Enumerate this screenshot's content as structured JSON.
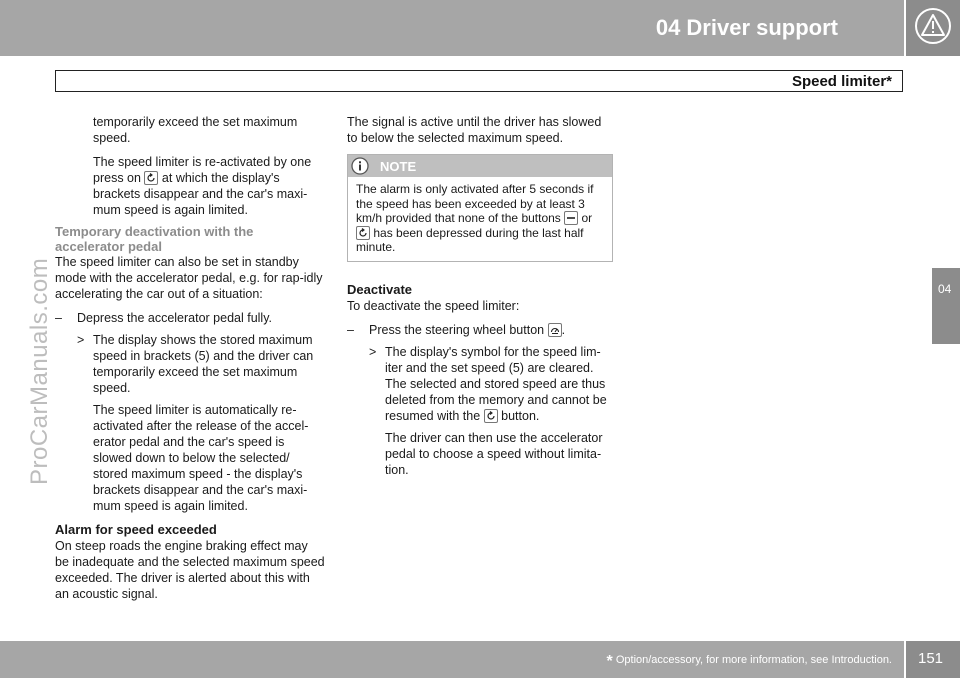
{
  "header": {
    "chapter_title": "04  Driver support",
    "section_title": "Speed limiter*",
    "icon": "warning-triangle-icon"
  },
  "side_tab": {
    "label": "04"
  },
  "watermark": "ProCarManuals.com",
  "footer": {
    "asterisk": "*",
    "note": "Option/accessory, for more information, see Introduction.",
    "page_number": "151"
  },
  "col1": {
    "p1": "temporarily exceed the set maximum speed.",
    "p2_a": "The speed limiter is re-activated by one press on",
    "p2_b": "at which the display's brackets disappear and the car's maxi-mum speed is again limited.",
    "heading_temp": "Temporary deactivation with the accelerator pedal",
    "p3": "The speed limiter can also be set in standby mode with the accelerator pedal, e.g. for rap-idly accelerating the car out of a situation:",
    "dash_marker": "–",
    "step1": "Depress the accelerator pedal fully.",
    "result_marker": ">",
    "result1": "The display shows the stored maximum speed in brackets (5) and the driver can temporarily exceed the set maximum speed.",
    "p4": "The speed limiter is automatically re-activated after the release of the accel-erator pedal and the car's speed is slowed down to below the selected/ stored maximum speed - the display's brackets disappear and the car's maxi-mum speed is again limited.",
    "heading_alarm": "Alarm for speed exceeded",
    "p5": "On steep roads the engine braking effect may be inadequate and the selected maximum speed exceeded. The driver is alerted about this with an acoustic signal."
  },
  "col2": {
    "p1": "The signal is active until the driver has slowed to below the selected maximum speed.",
    "note": {
      "label": "NOTE",
      "icon": "info-icon",
      "text_a": "The alarm is only activated after 5 seconds if the speed has been exceeded by at least 3 km/h provided that none of the buttons",
      "text_or": "or",
      "text_b": "has been depressed during the last half minute."
    },
    "heading_deactivate": "Deactivate",
    "p2": "To deactivate the speed limiter:",
    "dash_marker": "–",
    "step1": "Press the steering wheel button",
    "step1_end": ".",
    "result_marker": ">",
    "result1_a": "The display's symbol for the speed lim-iter and the set speed (5) are cleared. The selected and stored speed are thus deleted from the memory and cannot be resumed with the",
    "result1_b": "button.",
    "p3": "The driver can then use the accelerator pedal to choose a speed without limita-tion."
  }
}
